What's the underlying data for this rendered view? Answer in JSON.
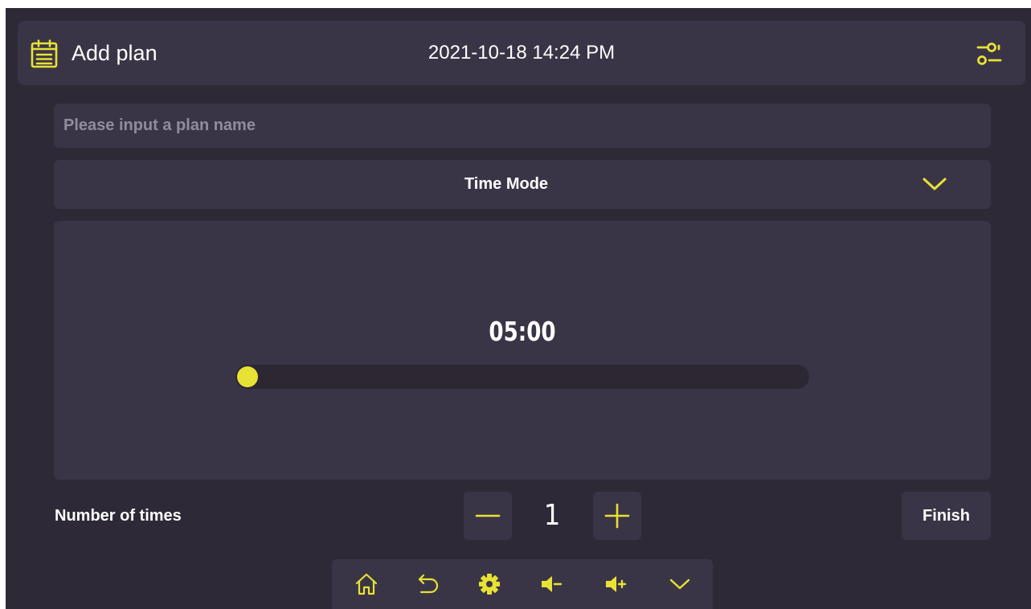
{
  "header": {
    "title": "Add plan",
    "datetime": "2021-10-18 14:24 PM"
  },
  "plan_name": {
    "placeholder": "Please input a plan name",
    "value": ""
  },
  "mode_select": {
    "selected": "Time Mode"
  },
  "timer": {
    "display": "05:00",
    "slider_fraction": 0
  },
  "times": {
    "label": "Number of times",
    "value": "1"
  },
  "finish_label": "Finish",
  "icons": {
    "header_left": "calendar-icon",
    "header_right": "sliders-icon",
    "dropdown": "chevron-down-icon",
    "decrement": "minus-icon",
    "increment": "plus-icon",
    "nav": [
      "home-icon",
      "back-icon",
      "gear-icon",
      "volume-down-icon",
      "volume-up-icon",
      "chevron-down-icon"
    ]
  },
  "colors": {
    "accent": "#e8e234",
    "background": "#2e2937",
    "surface": "#3a3546",
    "track": "#2c2733",
    "text": "#ffffff",
    "placeholder": "#918c9b"
  }
}
